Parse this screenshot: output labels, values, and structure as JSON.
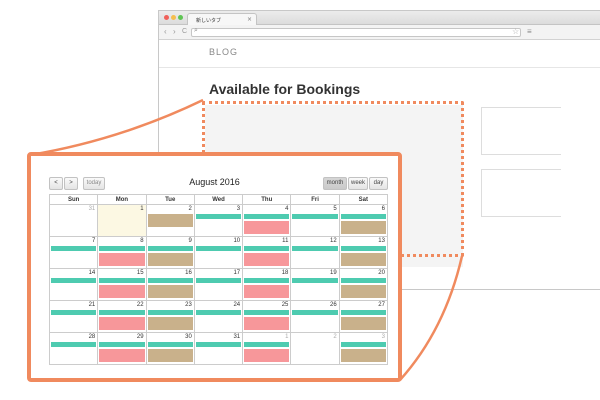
{
  "browser": {
    "tab_title": "新しいタブ",
    "tab_close": "×",
    "back": "‹",
    "forward": "›",
    "reload": "C",
    "search_glyph": "⌕",
    "star": "☆",
    "menu": "≡"
  },
  "page": {
    "nav_label": "BLOG",
    "section_title": "Available for Bookings"
  },
  "calendar": {
    "prev": "<",
    "next": ">",
    "today_label": "today",
    "title": "August 2016",
    "views": {
      "month": "month",
      "week": "week",
      "day": "day"
    },
    "days_of_week": [
      "Sun",
      "Mon",
      "Tue",
      "Wed",
      "Thu",
      "Fri",
      "Sat"
    ],
    "weeks": [
      [
        "31",
        "1",
        "2",
        "3",
        "4",
        "5",
        "6"
      ],
      [
        "7",
        "8",
        "9",
        "10",
        "11",
        "12",
        "13"
      ],
      [
        "14",
        "15",
        "16",
        "17",
        "18",
        "19",
        "20"
      ],
      [
        "21",
        "22",
        "23",
        "24",
        "25",
        "26",
        "27"
      ],
      [
        "28",
        "29",
        "30",
        "31",
        "1",
        "2",
        "3"
      ]
    ],
    "colors": {
      "teal": "#4ecbb0",
      "red": "#f7979a",
      "tan": "#c9b18b",
      "accent": "#f08a5e"
    }
  }
}
